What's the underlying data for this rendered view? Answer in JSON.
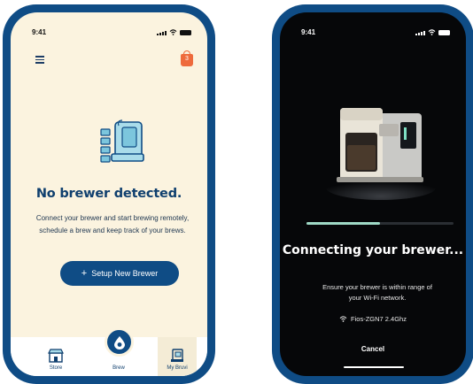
{
  "left_screen": {
    "status_time": "9:41",
    "cart_count": "3",
    "headline": "No brewer detected.",
    "description": "Connect your brewer and start brewing remotely, schedule a brew and keep track of your brews.",
    "setup_button": "Setup New Brewer",
    "tabs": [
      {
        "label": "Store",
        "icon": "store-icon"
      },
      {
        "label": "Brew",
        "icon": "brew-drop-icon"
      },
      {
        "label": "My Bruvi",
        "icon": "my-bruvi-icon"
      }
    ],
    "colors": {
      "accent": "#0f4c85",
      "background": "#fbf3df",
      "cart": "#ee6a3c"
    }
  },
  "right_screen": {
    "status_time": "9:41",
    "progress": 0.5,
    "title": "Connecting your brewer...",
    "description": "Ensure your brewer is within range of your Wi-Fi network.",
    "network_name": "Fios-ZGN7 2.4Ghz",
    "cancel_label": "Cancel",
    "colors": {
      "background": "#060709",
      "progress": "#9fd9c6"
    }
  }
}
